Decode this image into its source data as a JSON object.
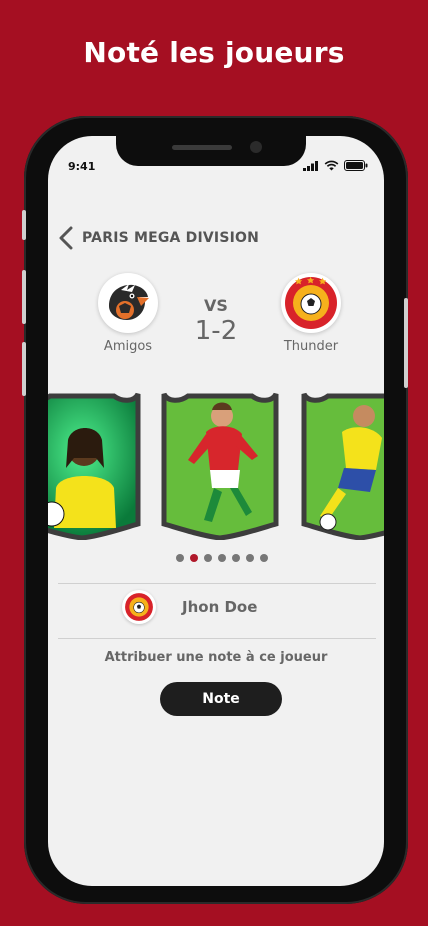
{
  "headline": "Noté les joueurs",
  "status": {
    "time": "9:41"
  },
  "header": {
    "league": "PARIS MEGA DIVISION"
  },
  "match": {
    "vs": "VS",
    "score": "1-2",
    "home": {
      "name": "Amigos"
    },
    "away": {
      "name": "Thunder"
    }
  },
  "carousel": {
    "page_count": 7,
    "active_index": 1
  },
  "player": {
    "name": "Jhon Doe"
  },
  "rating": {
    "prompt": "Attribuer une note à ce joueur",
    "button": "Note"
  },
  "colors": {
    "brand": "#A50F22",
    "button": "#1E1E1E",
    "dot_active": "#B0182A"
  }
}
